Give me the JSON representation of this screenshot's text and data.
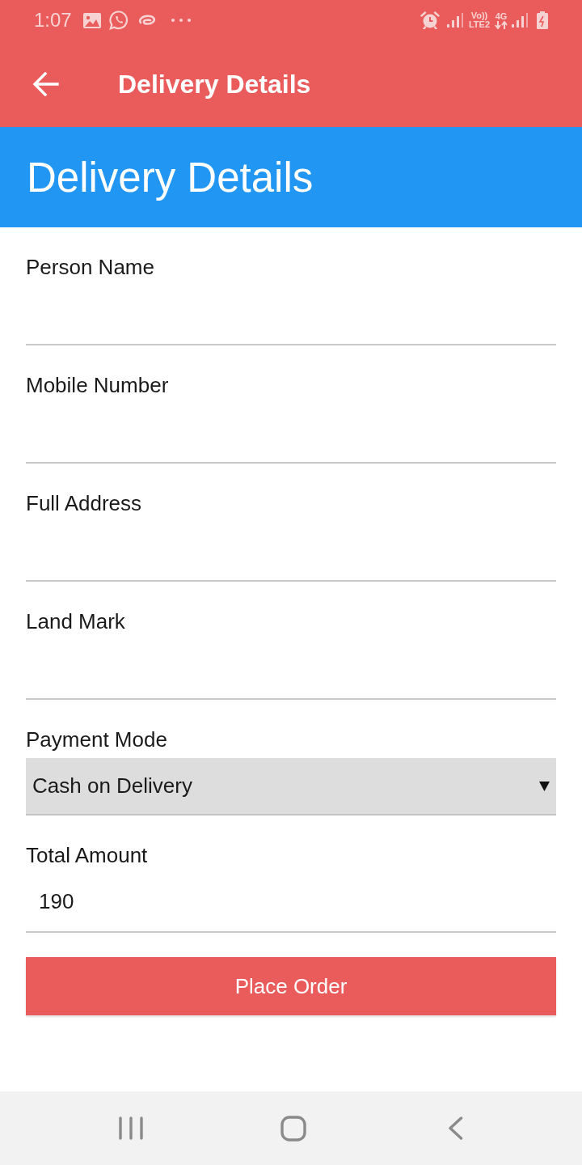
{
  "status_bar": {
    "time": "1:07",
    "volte_labels": [
      "Vo))",
      "LTE2"
    ],
    "network_label": "4G"
  },
  "app_bar": {
    "title": "Delivery Details"
  },
  "header": {
    "title": "Delivery Details"
  },
  "fields": [
    {
      "kind": "text",
      "label": "Person Name"
    },
    {
      "kind": "text",
      "label": "Mobile Number"
    },
    {
      "kind": "text",
      "label": "Full Address"
    },
    {
      "kind": "text",
      "label": "Land Mark"
    },
    {
      "kind": "select",
      "label": "Payment Mode",
      "value": "Cash on Delivery"
    },
    {
      "kind": "text",
      "label": "Total Amount",
      "value": "190"
    }
  ],
  "button": {
    "label": "Place Order"
  }
}
